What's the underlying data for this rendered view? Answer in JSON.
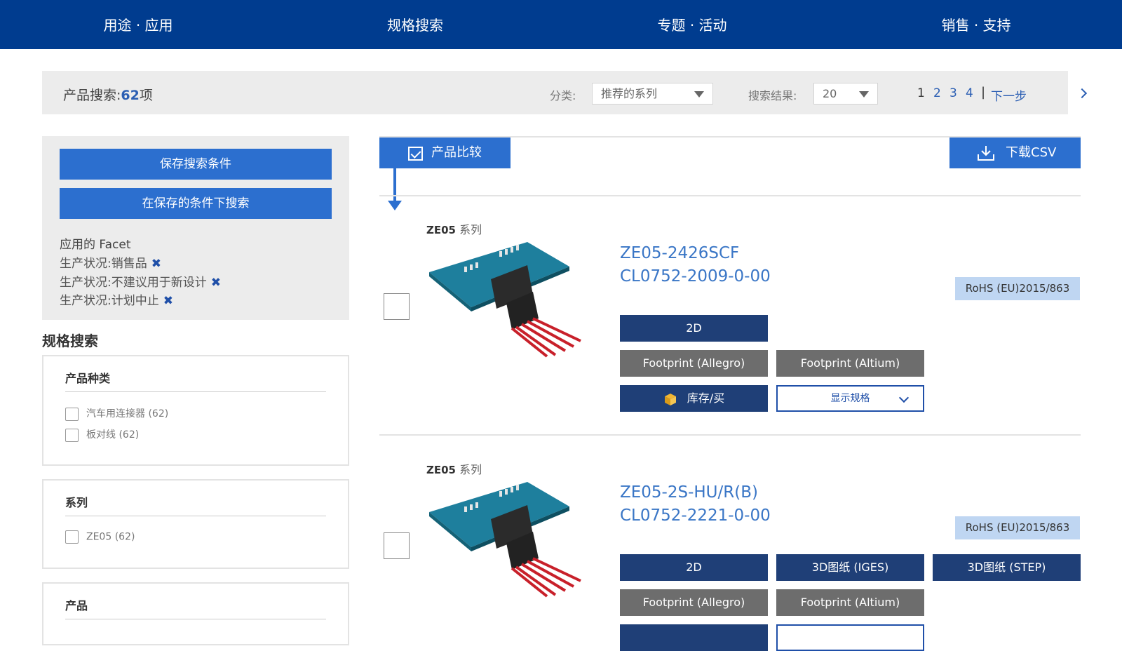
{
  "nav": {
    "items": [
      "用途 · 应用",
      "规格搜索",
      "专题 · 活动",
      "销售 · 支持"
    ]
  },
  "search": {
    "title_prefix": "产品搜索:",
    "count": "62",
    "count_suffix": "项",
    "sort_label": "分类:",
    "sort_value": "推荐的系列",
    "results_label": "搜索结果:",
    "results_value": "20",
    "pages": [
      "1",
      "2",
      "3",
      "4"
    ],
    "current_page": "1",
    "separator": "|",
    "next_label": "下一步"
  },
  "saved": {
    "save_label": "保存搜索条件",
    "search_saved_label": "在保存的条件下搜索",
    "facet_title": "应用的 Facet",
    "facets": [
      "生产状况:销售品",
      "生产状况:不建议用于新设计",
      "生产状况:计划中止"
    ],
    "remove_glyph": "✖"
  },
  "spec_search": {
    "heading": "规格搜索",
    "groups": [
      {
        "title": "产品种类",
        "options": [
          {
            "label": "汽车用连接器",
            "count": "(62)"
          },
          {
            "label": "板对线",
            "count": "(62)"
          }
        ]
      },
      {
        "title": "系列",
        "options": [
          {
            "label": "ZE05",
            "count": "(62)"
          }
        ]
      },
      {
        "title": "产品",
        "options": []
      }
    ]
  },
  "toolbar": {
    "compare_label": "产品比较",
    "csv_label": "下载CSV"
  },
  "products": [
    {
      "series_code": "ZE05",
      "series_word": "系列",
      "part_number": "ZE05-2426SCF",
      "cl_number": "CL0752-2009-0-00",
      "rohs": "RoHS (EU)2015/863",
      "btn_2d": "2D",
      "btn_fp_allegro": "Footprint (Allegro)",
      "btn_fp_altium": "Footprint (Altium)",
      "btn_stock": "库存/买",
      "btn_spec": "显示规格"
    },
    {
      "series_code": "ZE05",
      "series_word": "系列",
      "part_number": "ZE05-2S-HU/R(B)",
      "cl_number": "CL0752-2221-0-00",
      "rohs": "RoHS (EU)2015/863",
      "btn_2d": "2D",
      "btn_3d_iges": "3D图纸 (IGES)",
      "btn_3d_step": "3D图纸 (STEP)",
      "btn_fp_allegro": "Footprint (Allegro)",
      "btn_fp_altium": "Footprint (Altium)"
    }
  ],
  "colors": {
    "nav_bg": "#003c8f",
    "primary_button": "#2c6fcf",
    "navy_button": "#1f3f77",
    "gray_button": "#6d6d6d",
    "link": "#3a76c6",
    "rohs_bg": "#bfd6f2"
  },
  "icons": {
    "compare": "checkbox-checked-icon",
    "csv": "download-icon",
    "stock": "package-icon",
    "spec": "chevron-down-icon",
    "next": "chevron-right-icon",
    "remove": "close-x-icon"
  }
}
